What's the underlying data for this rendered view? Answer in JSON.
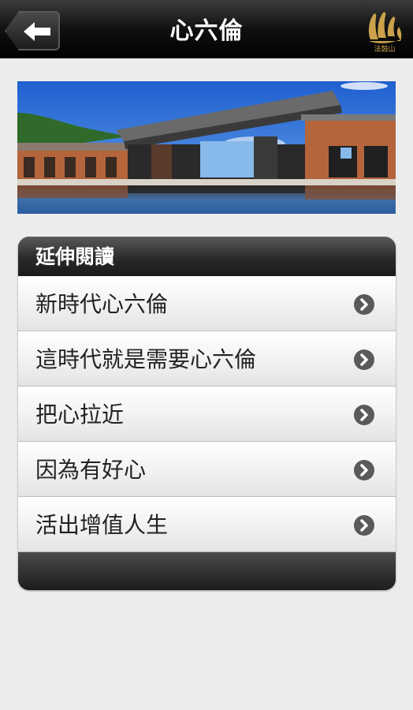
{
  "header": {
    "title": "心六倫",
    "back_icon": "arrow-left-icon",
    "logo_icon": "dharma-drum-logo-icon",
    "logo_text": "法鼓山"
  },
  "banner": {
    "image": "building-reflection-photo"
  },
  "panel": {
    "heading": "延伸閱讀",
    "items": [
      {
        "label": "新時代心六倫"
      },
      {
        "label": "這時代就是需要心六倫"
      },
      {
        "label": "把心拉近"
      },
      {
        "label": "因為有好心"
      },
      {
        "label": "活出增值人生"
      }
    ],
    "chevron_icon": "chevron-right-circle-icon"
  },
  "colors": {
    "topbar": "#111111",
    "background": "#ececec",
    "logo_gold": "#c9a24a"
  }
}
